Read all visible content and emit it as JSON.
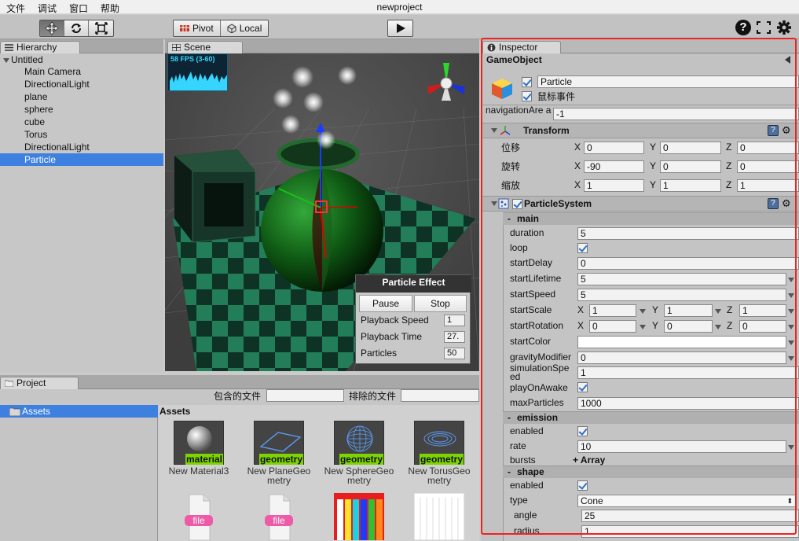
{
  "menubar": {
    "items": [
      "文件",
      "调试",
      "窗口",
      "帮助"
    ],
    "title": "newproject"
  },
  "toolbar": {
    "pivot_label": "Pivot",
    "local_label": "Local"
  },
  "hierarchy": {
    "tab_label": "Hierarchy",
    "root": "Untitled",
    "items": [
      "Main Camera",
      "DirectionalLight",
      "plane",
      "sphere",
      "cube",
      "Torus",
      "DirectionalLight",
      "Particle"
    ],
    "selected": "Particle"
  },
  "scene": {
    "tab_label": "Scene",
    "fps": "58 FPS (3-60)"
  },
  "particle_effect": {
    "title": "Particle Effect",
    "pause_label": "Pause",
    "stop_label": "Stop",
    "rows": [
      {
        "label": "Playback Speed",
        "value": "1"
      },
      {
        "label": "Playback Time",
        "value": "27."
      },
      {
        "label": "Particles",
        "value": "50"
      }
    ]
  },
  "project": {
    "tab_label": "Project",
    "include_label": "包含的文件",
    "exclude_label": "排除的文件",
    "tree_item": "Assets",
    "grid_title": "Assets",
    "assets": [
      {
        "tag": "material",
        "name": "New Material3"
      },
      {
        "tag": "geometry",
        "name": "New PlaneGeo metry"
      },
      {
        "tag": "geometry",
        "name": "New SphereGeo metry"
      },
      {
        "tag": "geometry",
        "name": "New TorusGeo metry"
      }
    ],
    "file_tag": "file"
  },
  "inspector": {
    "tab_label": "Inspector",
    "header": "GameObject",
    "object_name": "Particle",
    "mouse_event_label": "鼠标事件",
    "nav_area_label": "navigationAre a",
    "nav_area_value": "-1",
    "transform": {
      "title": "Transform",
      "rows": [
        {
          "label": "位移",
          "x": "0",
          "y": "0",
          "z": "0"
        },
        {
          "label": "旋转",
          "x": "-90",
          "y": "0",
          "z": "0"
        },
        {
          "label": "缩放",
          "x": "1",
          "y": "1",
          "z": "1"
        }
      ],
      "axis_x": "X",
      "axis_y": "Y",
      "axis_z": "Z"
    },
    "particle_system": {
      "title": "ParticleSystem",
      "main": {
        "title": "main",
        "duration_label": "duration",
        "duration": "5",
        "loop_label": "loop",
        "start_delay_label": "startDelay",
        "start_delay": "0",
        "start_lifetime_label": "startLifetime",
        "start_lifetime": "5",
        "start_speed_label": "startSpeed",
        "start_speed": "5",
        "start_scale_label": "startScale",
        "start_scale": {
          "x": "1",
          "y": "1",
          "z": "1"
        },
        "start_rotation_label": "startRotation",
        "start_rotation": {
          "x": "0",
          "y": "0",
          "z": "0"
        },
        "start_color_label": "startColor",
        "gravity_label": "gravityModifier",
        "gravity": "0",
        "sim_speed_label": "simulationSpe ed",
        "sim_speed": "1",
        "play_on_awake_label": "playOnAwake",
        "max_particles_label": "maxParticles",
        "max_particles": "1000"
      },
      "emission": {
        "title": "emission",
        "enabled_label": "enabled",
        "rate_label": "rate",
        "rate": "10",
        "bursts_label": "bursts",
        "bursts_value": "+ Array"
      },
      "shape": {
        "title": "shape",
        "enabled_label": "enabled",
        "type_label": "type",
        "type_value": "Cone",
        "angle_label": "angle",
        "angle": "25",
        "radius_label": "radius",
        "radius": "1"
      }
    }
  }
}
